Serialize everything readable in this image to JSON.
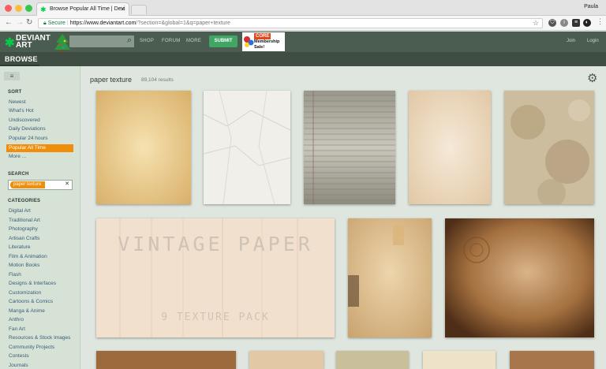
{
  "browser": {
    "tab_title": "Browse Popular All Time | Devi",
    "profile": "Paula",
    "secure_label": "Secure",
    "url_host": "https://www.deviantart.com",
    "url_rest": "/?section=&global=1&q=paper+texture"
  },
  "header": {
    "logo_line1": "DEVIANT",
    "logo_line2": "ART",
    "nav": [
      "SHOP",
      "FORUM",
      "MORE"
    ],
    "submit": "SUBMIT",
    "ad": {
      "badge": "CORE",
      "line1": "Membership",
      "line2": "Sale!"
    },
    "join": "Join",
    "login": "Login"
  },
  "browse_label": "BROWSE",
  "sidebar": {
    "sort_heading": "SORT",
    "sort_items": [
      "Newest",
      "What's Hot",
      "Undiscovered",
      "Daily Deviations",
      "Popular 24 hours",
      "Popular All Time",
      "More ..."
    ],
    "active_sort": "Popular All Time",
    "search_heading": "SEARCH",
    "search_value": "paper texture",
    "categories_heading": "CATEGORIES",
    "categories": [
      "Digital Art",
      "Traditional Art",
      "Photography",
      "Artisan Crafts",
      "Literature",
      "Film & Animation",
      "Motion Books",
      "Flash",
      "Designs & Interfaces",
      "Customization",
      "Cartoons & Comics",
      "Manga & Anime",
      "Anthro",
      "Fan Art",
      "Resources & Stock Images",
      "Community Projects",
      "Contests",
      "Journals"
    ]
  },
  "main": {
    "title": "paper texture",
    "results": "89,104 results",
    "vintage_title": "VINTAGE PAPER",
    "vintage_subtitle": "9 TEXTURE PACK"
  },
  "colors": {
    "accent": "#ee8e0b",
    "brand_green": "#05cc47",
    "header": "#4b5c50",
    "page_bg": "#dfe6df"
  }
}
